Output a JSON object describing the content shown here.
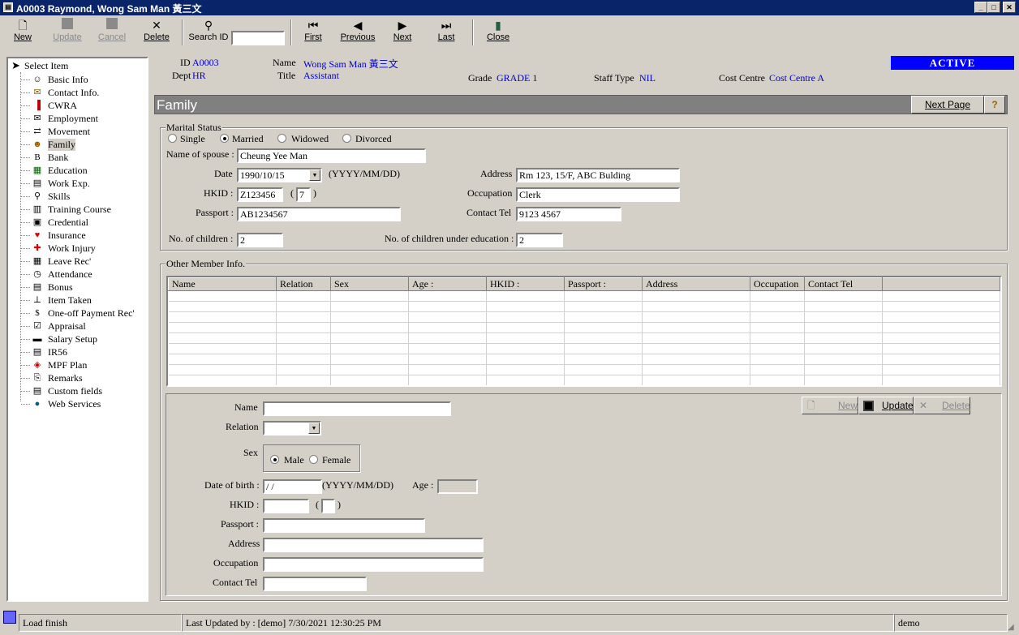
{
  "window": {
    "title": "A0003 Raymond, Wong Sam Man 黃三文"
  },
  "toolbar": {
    "new": "New",
    "update": "Update",
    "cancel": "Cancel",
    "delete": "Delete",
    "search_id": "Search ID",
    "search_value": "",
    "first": "First",
    "previous": "Previous",
    "next": "Next",
    "last": "Last",
    "close": "Close"
  },
  "tree": {
    "root": "Select Item",
    "items": [
      "Basic Info",
      "Contact Info.",
      "CWRA",
      "Employment",
      "Movement",
      "Family",
      "Bank",
      "Education",
      "Work Exp.",
      "Skills",
      "Training Course",
      "Credential",
      "Insurance",
      "Work Injury",
      "Leave Rec'",
      "Attendance",
      "Bonus",
      "Item Taken",
      "One-off Payment Rec'",
      "Appraisal",
      "Salary Setup",
      "IR56",
      "MPF Plan",
      "Remarks",
      "Custom fields",
      "Web Services"
    ],
    "icons": [
      "person-icon",
      "contact-icon",
      "cwra-icon",
      "mail-icon",
      "movement-icon",
      "family-face-icon",
      "bank-icon",
      "education-icon",
      "document-icon",
      "skills-icon",
      "training-icon",
      "credential-icon",
      "heart-icon",
      "red-cross-icon",
      "calendar-icon",
      "clock-icon",
      "bonus-icon",
      "item-icon",
      "money-icon",
      "appraisal-icon",
      "salary-icon",
      "ir56-icon",
      "mpf-icon",
      "paperclip-icon",
      "custom-fields-icon",
      "globe-icon"
    ],
    "selected": "Family"
  },
  "header": {
    "id_label": "ID",
    "id_value": "A0003",
    "name_label": "Name",
    "name_value": "Wong Sam Man  黃三文",
    "dept_label": "Dept",
    "dept_value": "HR",
    "title_label": "Title",
    "title_value": "Assistant",
    "grade_label": "Grade",
    "grade_value": "GRADE 1",
    "staff_type_label": "Staff Type",
    "staff_type_value": "NIL",
    "cost_centre_label": "Cost Centre",
    "cost_centre_value": "Cost Centre A",
    "status": "ACTIVE",
    "status_color": "#0000ff"
  },
  "section": {
    "title": "Family",
    "next_page": "Next Page",
    "help": "?"
  },
  "marital": {
    "group_label": "Marital Status",
    "options": [
      "Single",
      "Married",
      "Widowed",
      "Divorced"
    ],
    "selected": "Married",
    "spouse_label": "Name of spouse :",
    "spouse_value": "Cheung Yee Man",
    "date_label": "Date",
    "date_value": "1990/10/15",
    "date_format": "(YYYY/MM/DD)",
    "hkid_label": "HKID :",
    "hkid_value": "Z123456",
    "hkid_check": "7",
    "passport_label": "Passport :",
    "passport_value": "AB1234567",
    "address_label": "Address",
    "address_value": "Rm 123, 15/F, ABC Bulding",
    "occupation_label": "Occupation",
    "occupation_value": "Clerk",
    "contact_label": "Contact Tel",
    "contact_value": "9123 4567",
    "children_label": "No. of children :",
    "children_value": "2",
    "children_edu_label": "No. of children under education :",
    "children_edu_value": "2"
  },
  "other_members": {
    "group_label": "Other Member Info.",
    "columns": [
      "Name",
      "Relation",
      "Sex",
      "Age :",
      "HKID :",
      "Passport :",
      "Address",
      "Occupation",
      "Contact Tel"
    ]
  },
  "member_form": {
    "name_label": "Name",
    "name_value": "",
    "relation_label": "Relation",
    "relation_value": "",
    "sex_label": "Sex",
    "sex_options": [
      "Male",
      "Female"
    ],
    "sex_selected": "Male",
    "dob_label": "Date of birth :",
    "dob_value": " / /",
    "dob_format": "(YYYY/MM/DD)",
    "age_label": "Age :",
    "age_value": "",
    "hkid_label": "HKID :",
    "passport_label": "Passport :",
    "address_label": "Address",
    "occupation_label": "Occupation",
    "contact_label": "Contact Tel",
    "btn_new": "New",
    "btn_update": "Update",
    "btn_delete": "Delete"
  },
  "statusbar": {
    "message": "Load finish",
    "last_updated": "Last Updated by : [demo]  7/30/2021 12:30:25 PM",
    "user": "demo"
  }
}
